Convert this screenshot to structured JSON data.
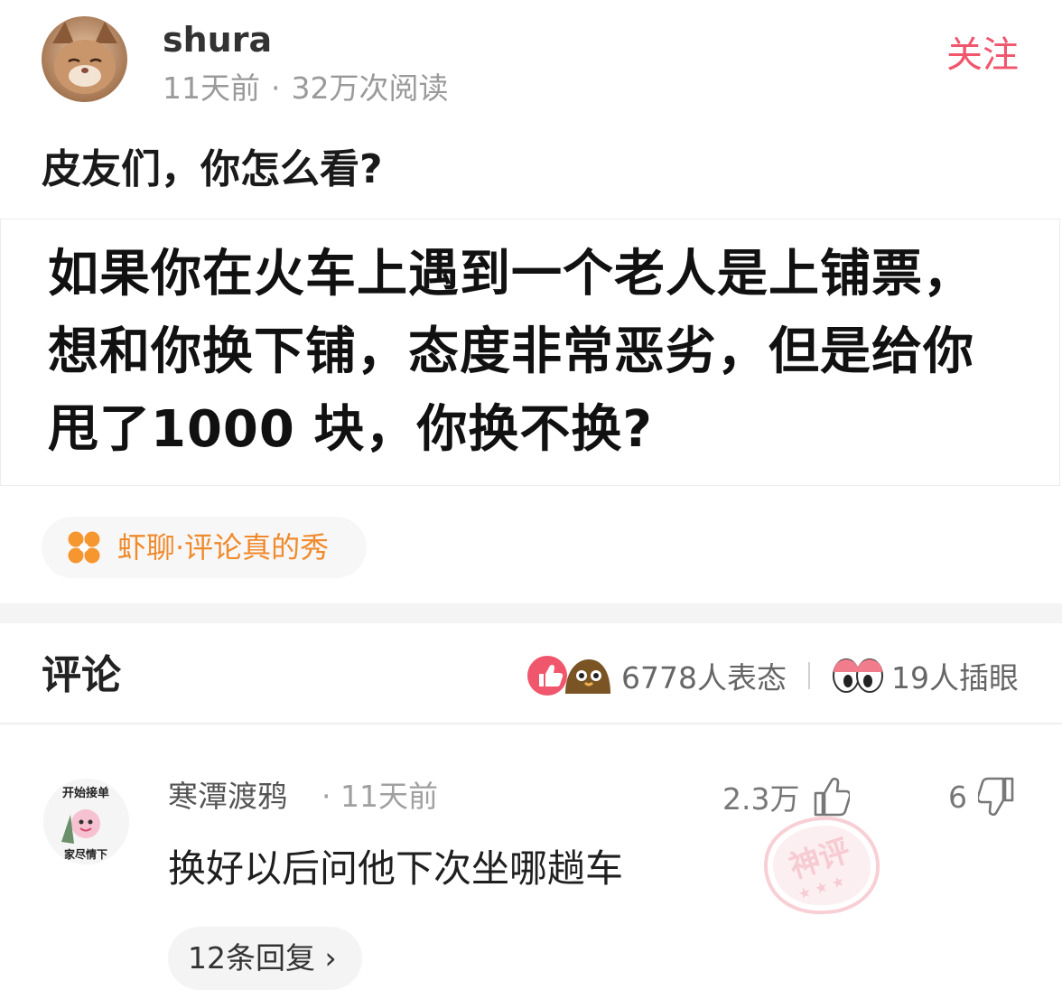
{
  "post": {
    "author": {
      "name": "shura",
      "time": "11天前",
      "separator": "·",
      "reads": "32万次阅读"
    },
    "follow_label": "关注",
    "title": "皮友们，你怎么看?",
    "question": "如果你在火车上遇到一个老人是上铺票，想和你换下铺，态度非常恶劣，但是给你甩了1000 块，你换不换?",
    "topic": "虾聊·评论真的秀"
  },
  "comments_section": {
    "title": "评论",
    "reactions_label": "6778人表态",
    "peek_label": "19人插眼",
    "colors": {
      "accent_pink": "#f0566c",
      "topic_orange": "#f08a2c"
    }
  },
  "comment": {
    "user": "寒潭渡鸦",
    "time": "· 11天前",
    "likes": "2.3万",
    "dislikes": "6",
    "text": "换好以后问他下次坐哪趟车",
    "replies_label": "12条回复 ›",
    "avatar_badge_top": "开始接单",
    "avatar_badge_bottom": "家尽情下",
    "stamp_text": "神评",
    "icons": {
      "like": "thumbs-up-icon",
      "dislike": "thumbs-down-icon"
    }
  }
}
